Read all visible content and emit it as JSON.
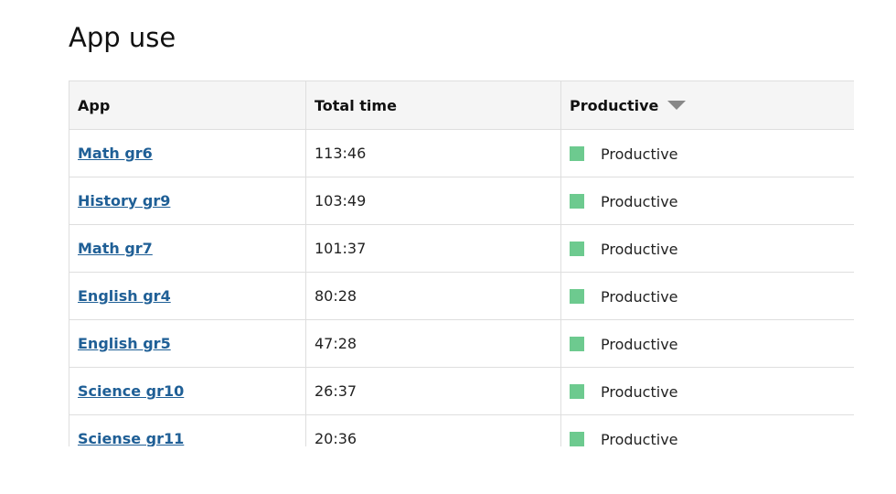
{
  "page": {
    "title": "App use"
  },
  "table": {
    "columns": {
      "app": "App",
      "total_time": "Total time",
      "productive": "Productive"
    },
    "sort": {
      "column": "productive",
      "direction": "descending",
      "icon": "caret-down-icon"
    },
    "colors": {
      "productive": "#6dca8f",
      "link": "#1f5f96",
      "header_bg": "#f5f5f5",
      "border": "#dedede"
    },
    "rows": [
      {
        "app": "Math gr6",
        "total_time": "113:46",
        "productive": "Productive"
      },
      {
        "app": "History gr9",
        "total_time": "103:49",
        "productive": "Productive"
      },
      {
        "app": "Math gr7",
        "total_time": "101:37",
        "productive": "Productive"
      },
      {
        "app": "English gr4",
        "total_time": "80:28",
        "productive": "Productive"
      },
      {
        "app": "English gr5",
        "total_time": "47:28",
        "productive": "Productive"
      },
      {
        "app": "Science gr10",
        "total_time": "26:37",
        "productive": "Productive"
      },
      {
        "app": "Sciense gr11",
        "total_time": "20:36",
        "productive": "Productive"
      }
    ]
  }
}
